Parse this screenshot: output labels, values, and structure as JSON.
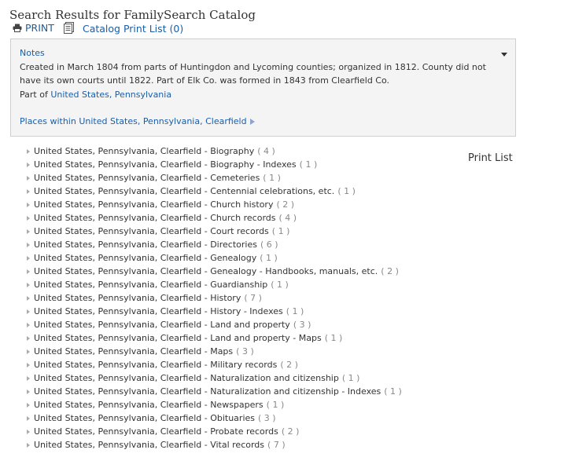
{
  "page": {
    "title": "Search Results for FamilySearch Catalog"
  },
  "toolbar": {
    "print_label": "PRINT",
    "catalog_list_label": "Catalog Print List (0)"
  },
  "notes": {
    "label": "Notes",
    "text": "Created in March 1804 from parts of Huntingdon and Lycoming counties; organized in 1812. County did not have its own courts until 1822. Part of Elk Co. was formed in 1843 from Clearfield Co.",
    "part_of_prefix": "Part of",
    "part_of_link": "United States, Pennsylvania",
    "places_link": "Places within United States, Pennsylvania, Clearfield"
  },
  "print_list_label": "Print List",
  "results": [
    {
      "name": "United States, Pennsylvania, Clearfield - Biography",
      "count": "( 4 )"
    },
    {
      "name": "United States, Pennsylvania, Clearfield - Biography - Indexes",
      "count": "( 1 )"
    },
    {
      "name": "United States, Pennsylvania, Clearfield - Cemeteries",
      "count": "( 1 )"
    },
    {
      "name": "United States, Pennsylvania, Clearfield - Centennial celebrations, etc.",
      "count": "( 1 )"
    },
    {
      "name": "United States, Pennsylvania, Clearfield - Church history",
      "count": "( 2 )"
    },
    {
      "name": "United States, Pennsylvania, Clearfield - Church records",
      "count": "( 4 )"
    },
    {
      "name": "United States, Pennsylvania, Clearfield - Court records",
      "count": "( 1 )"
    },
    {
      "name": "United States, Pennsylvania, Clearfield - Directories",
      "count": "( 6 )"
    },
    {
      "name": "United States, Pennsylvania, Clearfield - Genealogy",
      "count": "( 1 )"
    },
    {
      "name": "United States, Pennsylvania, Clearfield - Genealogy - Handbooks, manuals, etc.",
      "count": "( 2 )"
    },
    {
      "name": "United States, Pennsylvania, Clearfield - Guardianship",
      "count": "( 1 )"
    },
    {
      "name": "United States, Pennsylvania, Clearfield - History",
      "count": "( 7 )"
    },
    {
      "name": "United States, Pennsylvania, Clearfield - History - Indexes",
      "count": "( 1 )"
    },
    {
      "name": "United States, Pennsylvania, Clearfield - Land and property",
      "count": "( 3 )"
    },
    {
      "name": "United States, Pennsylvania, Clearfield - Land and property - Maps",
      "count": "( 1 )"
    },
    {
      "name": "United States, Pennsylvania, Clearfield - Maps",
      "count": "( 3 )"
    },
    {
      "name": "United States, Pennsylvania, Clearfield - Military records",
      "count": "( 2 )"
    },
    {
      "name": "United States, Pennsylvania, Clearfield - Naturalization and citizenship",
      "count": "( 1 )"
    },
    {
      "name": "United States, Pennsylvania, Clearfield - Naturalization and citizenship - Indexes",
      "count": "( 1 )"
    },
    {
      "name": "United States, Pennsylvania, Clearfield - Newspapers",
      "count": "( 1 )"
    },
    {
      "name": "United States, Pennsylvania, Clearfield - Obituaries",
      "count": "( 3 )"
    },
    {
      "name": "United States, Pennsylvania, Clearfield - Probate records",
      "count": "( 2 )"
    },
    {
      "name": "United States, Pennsylvania, Clearfield - Vital records",
      "count": "( 7 )"
    }
  ]
}
